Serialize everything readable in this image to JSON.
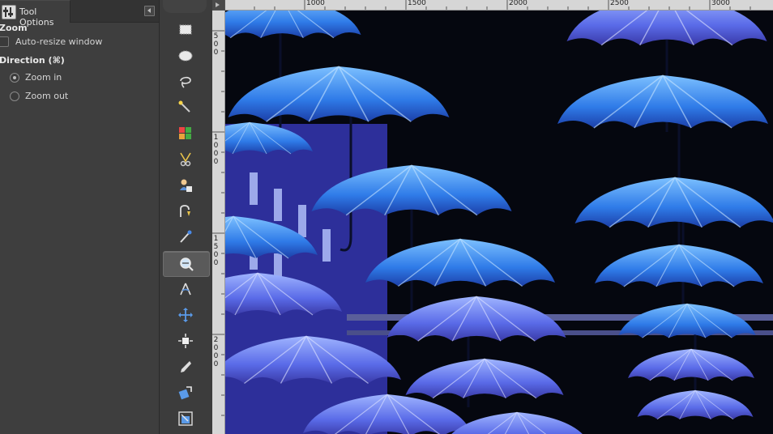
{
  "tool_options": {
    "tab_label": "Tool Options",
    "zoom_heading": "Zoom",
    "auto_resize_label": "Auto-resize window",
    "direction_heading": "Direction  (⌘)",
    "zoom_in_label": "Zoom in",
    "zoom_out_label": "Zoom out",
    "selected_direction": "Zoom in"
  },
  "toolbox": {
    "tools": [
      {
        "name": "rect-select-icon"
      },
      {
        "name": "ellipse-select-icon"
      },
      {
        "name": "lasso-icon"
      },
      {
        "name": "fuzzy-select-icon"
      },
      {
        "name": "color-select-icon"
      },
      {
        "name": "scissors-icon"
      },
      {
        "name": "foreground-select-icon"
      },
      {
        "name": "paths-icon"
      },
      {
        "name": "color-picker-icon"
      },
      {
        "name": "zoom-icon",
        "active": true
      },
      {
        "name": "measure-icon"
      },
      {
        "name": "move-icon"
      },
      {
        "name": "align-icon"
      },
      {
        "name": "crop-icon"
      },
      {
        "name": "rotate-icon"
      },
      {
        "name": "scale-icon"
      }
    ]
  },
  "rulers": {
    "top": [
      "1000",
      "1500",
      "2000",
      "2500",
      "3000"
    ],
    "left": [
      [
        "5",
        "0",
        "0"
      ],
      [
        "1",
        "0",
        "0",
        "0"
      ],
      [
        "1",
        "5",
        "0",
        "0"
      ],
      [
        "2",
        "0",
        "0",
        "0"
      ]
    ]
  },
  "colors": {
    "umbrella_light": "#6fb7ff",
    "umbrella_mid": "#2f78e8",
    "umbrella_dark": "#1d3fa8",
    "background": "#05070f"
  }
}
